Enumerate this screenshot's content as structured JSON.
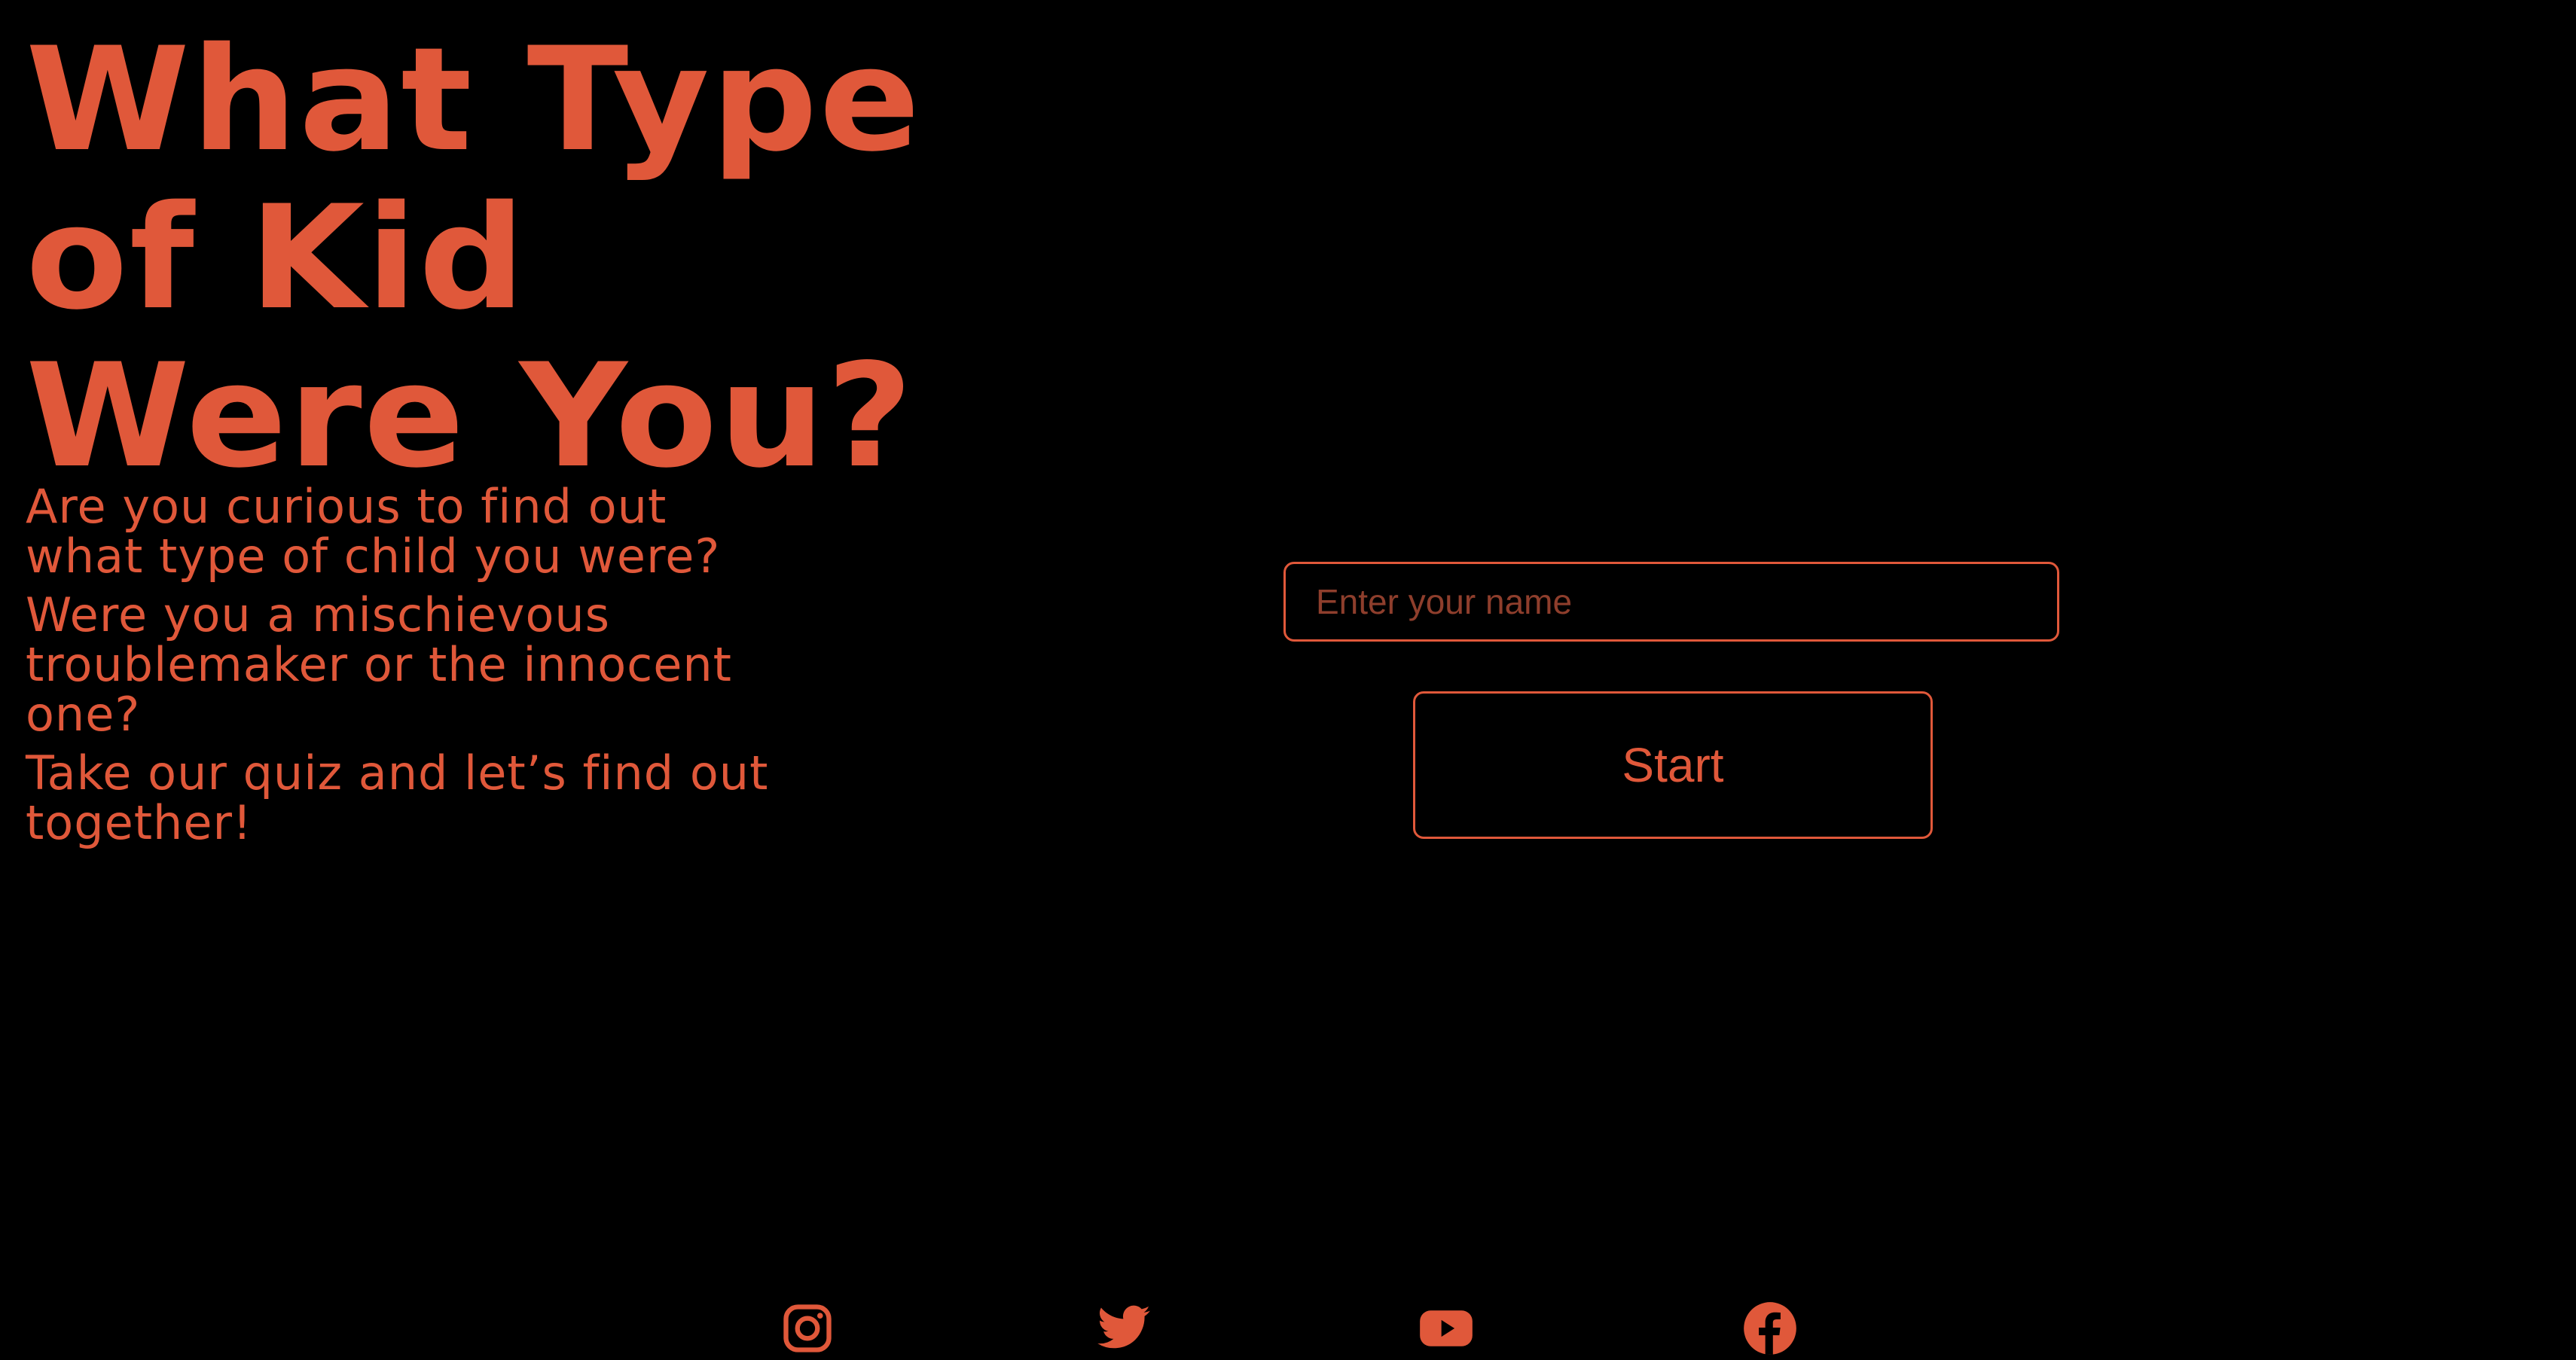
{
  "hero": {
    "title_lines": [
      "What Type",
      "of Kid",
      "Were You?"
    ],
    "paragraphs": [
      "Are you curious to find out what type of child you were?",
      "Were you a mischievous troublemaker or the innocent one?",
      "Take our quiz and let’s find out together!"
    ]
  },
  "form": {
    "name_placeholder": "Enter your name",
    "name_value": "",
    "start_label": "Start"
  },
  "social": {
    "icons": [
      "instagram-icon",
      "twitter-icon",
      "youtube-icon",
      "facebook-icon"
    ]
  },
  "theme": {
    "background": "#000000",
    "accent": "#E0583A"
  }
}
